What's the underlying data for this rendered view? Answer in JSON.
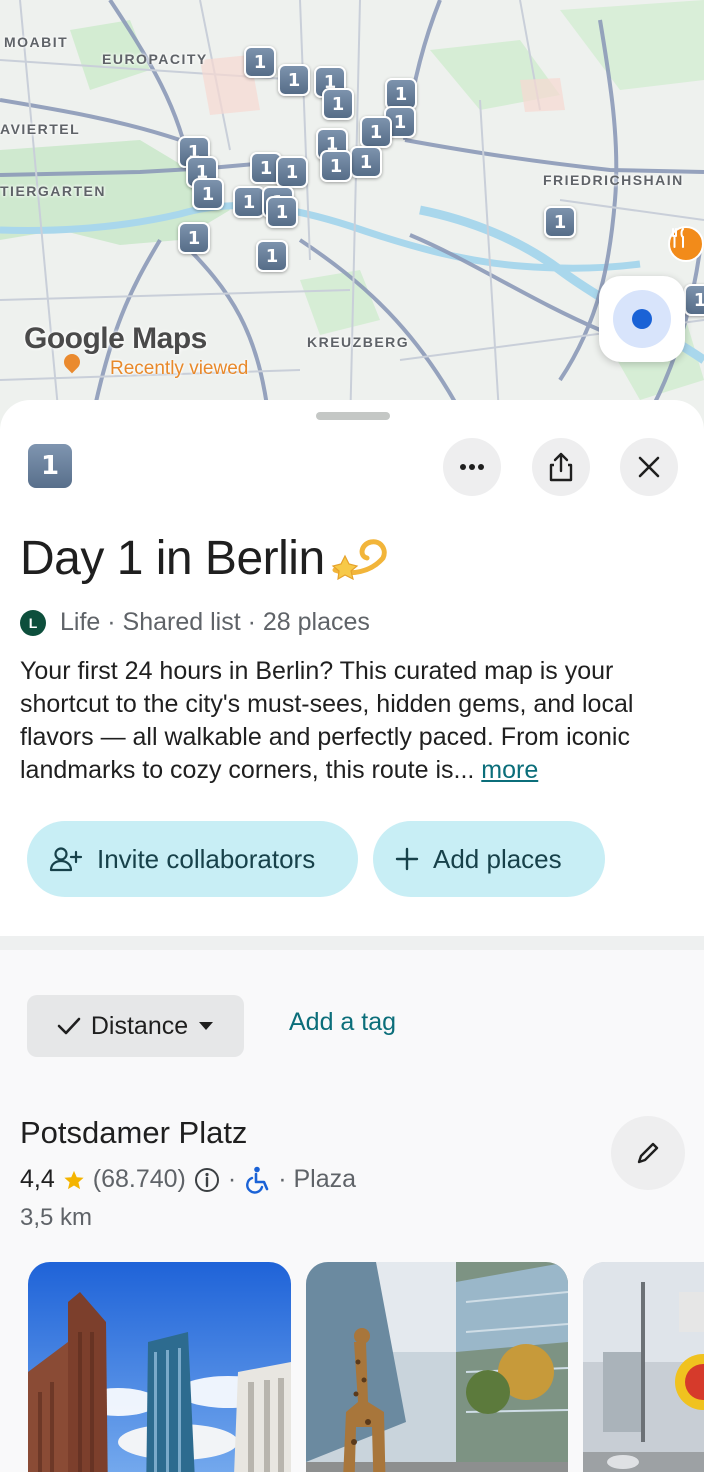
{
  "map": {
    "labels": [
      "MOABIT",
      "EUROPACITY",
      "AVIERTEL",
      "TIERGARTEN",
      "FRIEDRICHSHAIN",
      "KREUZBERG"
    ],
    "pin_label": "1",
    "logo_text": "Google Maps",
    "logo_subtext": "Recently viewed",
    "restaurant_icon": "fork-knife-icon",
    "location_icon": "my-location-icon"
  },
  "header": {
    "badge": "1",
    "more_icon": "more-horiz-icon",
    "share_icon": "share-icon",
    "close_icon": "close-icon"
  },
  "list": {
    "title": "Day 1 in Berlin",
    "title_emoji": "dizzy-star-emoji",
    "avatar_letter": "L",
    "meta": "Life · Shared list · 28 places",
    "description": "Your first 24 hours in Berlin? This curated map is your shortcut to the city's must-sees, hidden gems, and local flavors — all walkable and perfectly paced. From iconic landmarks to cozy corners, this route is... ",
    "more_link": "more"
  },
  "actions": {
    "invite_label": "Invite collaborators",
    "add_places_label": "Add places"
  },
  "filters": {
    "sort_label": "Distance",
    "add_tag_label": "Add a tag"
  },
  "place": {
    "name": "Potsdamer Platz",
    "rating": "4,4",
    "reviews": "(68.740)",
    "category": "· Plaza",
    "distance": "3,5 km",
    "accessible_icon": "wheelchair-icon",
    "info_icon": "info-icon"
  },
  "colors": {
    "accent_teal": "#0b6e7a",
    "pill_bg": "#c8eef5",
    "pin_blue": "#566d88",
    "star": "#f4b400"
  }
}
